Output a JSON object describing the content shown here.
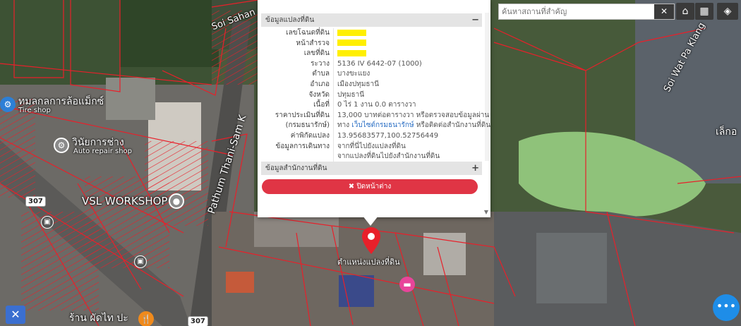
{
  "search": {
    "placeholder": "ค้นหาสถานที่สำคัญ",
    "clear": "✕"
  },
  "toolbar": {
    "home": "⌂",
    "grid": "▦",
    "layers": "◈"
  },
  "popup": {
    "parcel_section": "ข้อมูลแปลงที่ดิน",
    "parcel_sign": "−",
    "rows": [
      {
        "label": "เลขโฉนดที่ดิน",
        "value": ""
      },
      {
        "label": "หน้าสำรวจ",
        "value": ""
      },
      {
        "label": "เลขที่ดิน",
        "value": ""
      },
      {
        "label": "ระวาง",
        "value": "5136 IV 6442-07 (1000)"
      },
      {
        "label": "ตำบล",
        "value": "บางขะแยง"
      },
      {
        "label": "อำเภอ",
        "value": "เมืองปทุมธานี"
      },
      {
        "label": "จังหวัด",
        "value": "ปทุมธานี"
      },
      {
        "label": "เนื้อที่",
        "value": "0 ไร่ 1 งาน 0.0 ตารางวา"
      },
      {
        "label": "ราคาประเมินที่ดิน",
        "value": "13,000 บาทต่อตารางวา หรือตรวจสอบข้อมูลผ่าน"
      },
      {
        "label": "(กรมธนารักษ์)",
        "value_pre": "ทาง ",
        "value_link": "เว็บไซต์กรมธนารักษ์",
        "value_post": " หรือติดต่อสำนักงานที่ดิน"
      },
      {
        "label": "ค่าพิกัดแปลง",
        "value_link": "13.95683577,100.52756449"
      },
      {
        "label": "ข้อมูลการเดินทาง",
        "value_link": "จากที่นี่ไปยังแปลงที่ดิน"
      },
      {
        "label": "",
        "value_link": "จากแปลงที่ดินไปยังสำนักงานที่ดิน"
      }
    ],
    "office_section": "ข้อมูลสำนักงานที่ดิน",
    "office_sign": "+",
    "close_label": "✖ ปิดหน้าต่าง",
    "scroll_down": "▼"
  },
  "map": {
    "labels": {
      "tire_th": "ทมลกลการล้อแม็กซ์",
      "tire_en": "Tire shop",
      "repair_th": "วินัยการช่าง",
      "repair_en": "Auto repair shop",
      "vsl": "VSL WORKSHOP",
      "road_pathum": "Pathum Thani-Sam K",
      "soi_sahan": "Soi Sahan",
      "soi_wat": "Soi Wat Pa Klang",
      "lek": "เล็กอ",
      "parcel_pin_label": "ตำแหน่งแปลงที่ดิน",
      "restaurant": "ร้าน ผัดไท ปะ",
      "route_307_a": "307",
      "route_307_b": "307"
    }
  },
  "colors": {
    "parcel_line": "#e8202a",
    "close_button": "#e03545",
    "fab": "#1e8de8",
    "link": "#2b6fc4",
    "highlight": "#ffef00"
  },
  "fab_icon": "•••",
  "tool_x_icon": "✕"
}
